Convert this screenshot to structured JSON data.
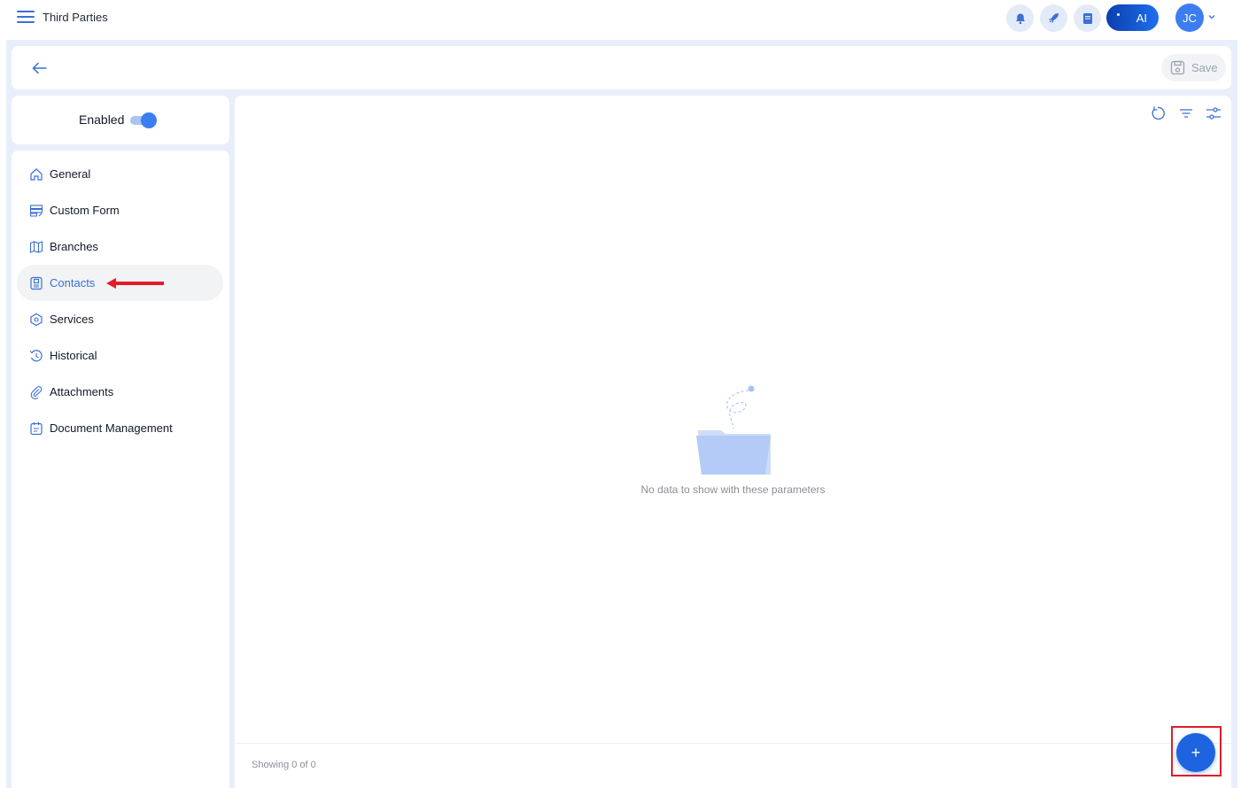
{
  "topbar": {
    "title": "Third Parties",
    "ai_label": "AI",
    "avatar_initials": "JC",
    "icons": [
      "bell-icon",
      "rocket-icon",
      "book-icon"
    ]
  },
  "header": {
    "save_label": "Save"
  },
  "status": {
    "enabled_label": "Enabled",
    "enabled": true
  },
  "sidebar": {
    "items": [
      {
        "label": "General",
        "icon": "home-icon"
      },
      {
        "label": "Custom Form",
        "icon": "form-icon"
      },
      {
        "label": "Branches",
        "icon": "map-icon"
      },
      {
        "label": "Contacts",
        "icon": "contact-card-icon",
        "active": true
      },
      {
        "label": "Services",
        "icon": "hexagon-icon"
      },
      {
        "label": "Historical",
        "icon": "history-icon"
      },
      {
        "label": "Attachments",
        "icon": "paperclip-icon"
      },
      {
        "label": "Document Management",
        "icon": "document-icon"
      }
    ]
  },
  "main": {
    "empty_message": "No data to show with these parameters",
    "showing_text": "Showing 0 of 0",
    "fab_label": "+"
  },
  "colors": {
    "accent": "#3c7ef0",
    "fab": "#1e63e0",
    "frame": "#e8effb",
    "annotation": "#e11d2a"
  }
}
